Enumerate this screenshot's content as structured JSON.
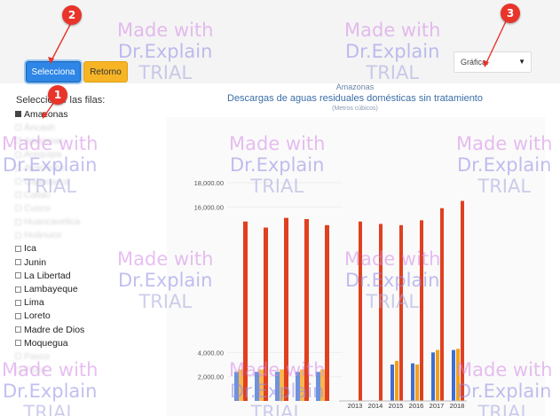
{
  "toolbar": {
    "select_button": "Selecciona",
    "back_button": "Retorno",
    "chart_select_value": "Gráfica:"
  },
  "markers": [
    "1",
    "2",
    "3"
  ],
  "chart_header": {
    "region": "Amazonas",
    "title": "Descargas de aguas residuales domésticas sin tratamiento",
    "subtitle": "(Metros cúbicos)"
  },
  "rows_label": "Seleccionar las filas:",
  "rows": [
    {
      "label": "Amazonas",
      "faint": false
    },
    {
      "label": "Áncash",
      "faint": true
    },
    {
      "label": "Apurímac",
      "faint": true
    },
    {
      "label": "Arequipa",
      "faint": true
    },
    {
      "label": "Ayacucho",
      "faint": true
    },
    {
      "label": "Cajamarca",
      "faint": true
    },
    {
      "label": "Callao",
      "faint": true
    },
    {
      "label": "Cusco",
      "faint": true
    },
    {
      "label": "Huancavelica",
      "faint": true
    },
    {
      "label": "Huánuco",
      "faint": true
    },
    {
      "label": "Ica",
      "faint": false
    },
    {
      "label": "Junin",
      "faint": false
    },
    {
      "label": "La Libertad",
      "faint": false
    },
    {
      "label": "Lambayeque",
      "faint": false
    },
    {
      "label": "Lima",
      "faint": false
    },
    {
      "label": "Loreto",
      "faint": false
    },
    {
      "label": "Madre de Dios",
      "faint": false
    },
    {
      "label": "Moquegua",
      "faint": false
    },
    {
      "label": "Pasco",
      "faint": true
    },
    {
      "label": "Piura",
      "faint": true
    }
  ],
  "watermark": {
    "line1": "Made with",
    "line2": "Dr.Explain",
    "line3": "TRIAL"
  },
  "colors": {
    "red": "#e0401f",
    "blue": "#3f6fd0",
    "orange": "#f5a01a",
    "accent": "#2e86e6"
  },
  "chart_data": {
    "type": "bar",
    "y_ticks": [
      "2,000.00",
      "4,000.00",
      "16,000.00",
      "18,000.00"
    ],
    "ylim": [
      0,
      18000
    ],
    "categories": [
      "2013",
      "2014",
      "2015",
      "2016",
      "2017",
      "2018"
    ],
    "series": [
      {
        "values": [
          0,
          0,
          3000,
          3100,
          4000,
          4200
        ]
      },
      {
        "values": [
          0,
          0,
          3300,
          3000,
          4200,
          4300
        ]
      },
      {
        "values": [
          14800,
          14600,
          14500,
          14900,
          15900,
          16500
        ]
      }
    ]
  }
}
